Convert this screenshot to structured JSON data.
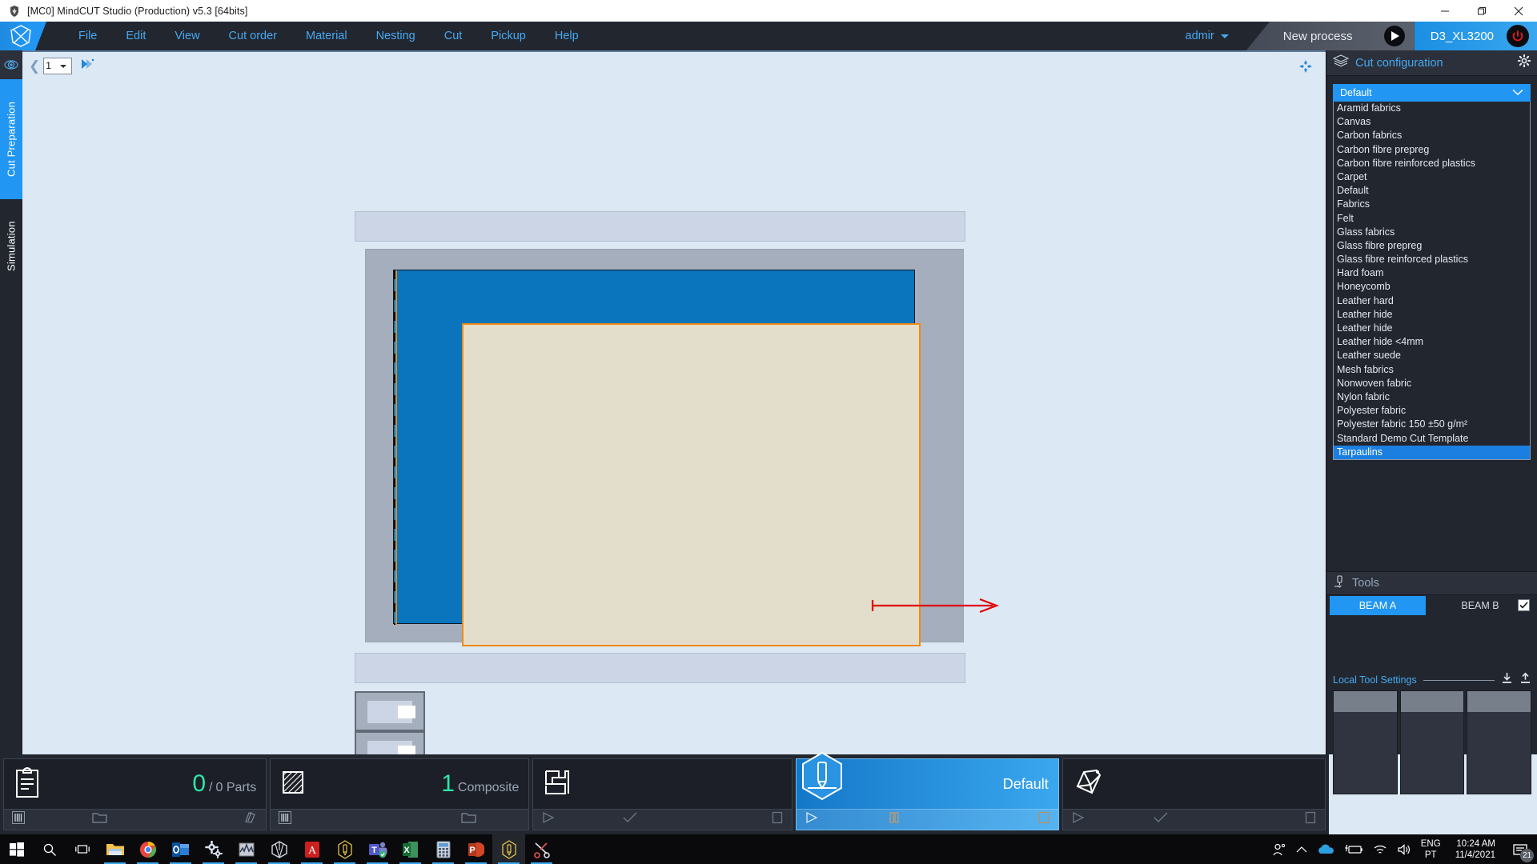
{
  "window": {
    "title": "[MC0] MindCUT Studio (Production) v5.3 [64bits]",
    "icon": "app-shield-icon",
    "minimize": "minimize-icon",
    "maximize": "maximize-icon",
    "close": "close-icon"
  },
  "menubar": {
    "logo": "mindcut-logo-icon",
    "items": [
      {
        "label": "File"
      },
      {
        "label": "Edit"
      },
      {
        "label": "View"
      },
      {
        "label": "Cut order"
      },
      {
        "label": "Material"
      },
      {
        "label": "Nesting"
      },
      {
        "label": "Cut"
      },
      {
        "label": "Pickup"
      },
      {
        "label": "Help"
      }
    ],
    "user": "admir",
    "process_tab": "New process",
    "machine_tab": "D3_XL3200",
    "power_icon": "power-icon",
    "play_icon": "play-icon"
  },
  "left_tabs": {
    "eye_icon": "eye-icon",
    "items": [
      {
        "label": "Cut Preparation",
        "active": true
      },
      {
        "label": "Simulation",
        "active": false
      }
    ]
  },
  "canvas": {
    "page_value": "1",
    "page_options": [
      "1"
    ],
    "prev_icon": "chevron-left-icon",
    "expand_icon": "expand-arrow-icon",
    "fullscreen_icon": "move-cross-icon",
    "graphic": {
      "description": "cutting table top view with material sheet and feed direction arrow",
      "arrow_color": "#e00000",
      "material_fill": "#e3decb",
      "material_border": "#ef8a11",
      "table_fill": "#0a74bd",
      "frame_fill": "#a5aebd",
      "beam_fill": "#ccd5e6"
    }
  },
  "right_panel": {
    "cut_configuration": {
      "icon": "layers-icon",
      "title": "Cut configuration",
      "gear_icon": "gear-icon",
      "selected": "Default",
      "chevron_icon": "chevron-down-icon",
      "options": [
        {
          "label": "Aramid fabrics",
          "selected": false
        },
        {
          "label": "Canvas",
          "selected": false
        },
        {
          "label": "Carbon fabrics",
          "selected": false
        },
        {
          "label": "Carbon fibre prepreg",
          "selected": false
        },
        {
          "label": "Carbon fibre reinforced plastics",
          "selected": false
        },
        {
          "label": "Carpet",
          "selected": false
        },
        {
          "label": "Default",
          "selected": false
        },
        {
          "label": "Fabrics",
          "selected": false
        },
        {
          "label": "Felt",
          "selected": false
        },
        {
          "label": "Glass fabrics",
          "selected": false
        },
        {
          "label": "Glass fibre prepreg",
          "selected": false
        },
        {
          "label": "Glass fibre reinforced plastics",
          "selected": false
        },
        {
          "label": "Hard foam",
          "selected": false
        },
        {
          "label": "Honeycomb",
          "selected": false
        },
        {
          "label": "Leather hard",
          "selected": false
        },
        {
          "label": "Leather hide",
          "selected": false
        },
        {
          "label": "Leather hide",
          "selected": false
        },
        {
          "label": "Leather hide <4mm",
          "selected": false
        },
        {
          "label": "Leather suede",
          "selected": false
        },
        {
          "label": "Mesh fabrics",
          "selected": false
        },
        {
          "label": "Nonwoven fabric",
          "selected": false
        },
        {
          "label": "Nylon fabric",
          "selected": false
        },
        {
          "label": "Polyester fabric",
          "selected": false
        },
        {
          "label": "Polyester fabric 150 ±50 g/m²",
          "selected": false
        },
        {
          "label": "Standard Demo Cut Template",
          "selected": false
        },
        {
          "label": "Tarpaulins",
          "selected": true
        }
      ]
    },
    "tools": {
      "icon": "tool-head-icon",
      "title": "Tools",
      "beam_a": "BEAM A",
      "beam_b": "BEAM B",
      "beam_b_checked": true,
      "local_tool_settings": "Local Tool Settings",
      "import_icon": "download-icon",
      "export_icon": "upload-icon",
      "columns": 3
    }
  },
  "status_cards": [
    {
      "name": "parts",
      "icon": "clipboard-icon",
      "value": "0",
      "separator": "/",
      "total": "0 Parts",
      "active": false,
      "actions": [
        "barcode-icon",
        "folder-icon",
        "parts-icon"
      ]
    },
    {
      "name": "composite",
      "icon": "hatch-square-icon",
      "value": "1",
      "label": "Composite",
      "active": false,
      "actions": [
        "barcode-icon",
        "folder-icon"
      ]
    },
    {
      "name": "nesting",
      "icon": "nesting-icon",
      "value": "",
      "label": "",
      "active": false,
      "actions": [
        "play-icon",
        "check-icon",
        "stop-icon"
      ]
    },
    {
      "name": "cut",
      "icon": "cut-tool-hex-icon",
      "value": "",
      "label": "Default",
      "active": true,
      "actions": [
        "play-icon",
        "pause-icon",
        "stop-icon"
      ]
    },
    {
      "name": "pickup",
      "icon": "pickup-icon",
      "value": "",
      "label": "",
      "active": false,
      "actions": [
        "play-icon",
        "check-icon",
        "stop-icon"
      ]
    }
  ],
  "taskbar": {
    "items": [
      {
        "name": "start-button",
        "icon": "windows-logo-icon"
      },
      {
        "name": "search-button",
        "icon": "search-icon"
      },
      {
        "name": "task-view-button",
        "icon": "task-view-icon"
      },
      {
        "name": "file-explorer",
        "icon": "folder-icon",
        "open": true
      },
      {
        "name": "google-chrome",
        "icon": "chrome-icon",
        "open": true
      },
      {
        "name": "outlook",
        "icon": "outlook-icon",
        "open": true
      },
      {
        "name": "settings-app",
        "icon": "gears-icon",
        "open": true
      },
      {
        "name": "media-app",
        "icon": "wave-icon",
        "open": true
      },
      {
        "name": "mindcut-nest",
        "icon": "hex-gem-icon",
        "open": true
      },
      {
        "name": "adobe-acrobat",
        "icon": "acrobat-icon",
        "open": true
      },
      {
        "name": "mindcut-studio-1",
        "icon": "hex-pen-icon",
        "open": true
      },
      {
        "name": "microsoft-teams",
        "icon": "teams-icon",
        "open": true
      },
      {
        "name": "microsoft-excel",
        "icon": "excel-icon",
        "open": true
      },
      {
        "name": "calculator",
        "icon": "calculator-icon",
        "open": true
      },
      {
        "name": "powerpoint",
        "icon": "powerpoint-icon",
        "open": true
      },
      {
        "name": "mindcut-studio-2",
        "icon": "hex-pen-icon",
        "open": true,
        "highlight": true
      },
      {
        "name": "snip-tool",
        "icon": "scissors-icon",
        "open": true
      }
    ],
    "tray": {
      "people_icon": "people-icon",
      "chevron_icon": "chevron-up-icon",
      "onedrive_icon": "onedrive-icon",
      "battery_icon": "battery-charging-icon",
      "network_icon": "wifi-icon",
      "volume_icon": "speaker-icon",
      "lang_line1": "ENG",
      "lang_line2": "PT",
      "time": "10:24 AM",
      "date": "11/4/2021",
      "notifications_icon": "notification-icon",
      "notifications_count": "21"
    }
  }
}
